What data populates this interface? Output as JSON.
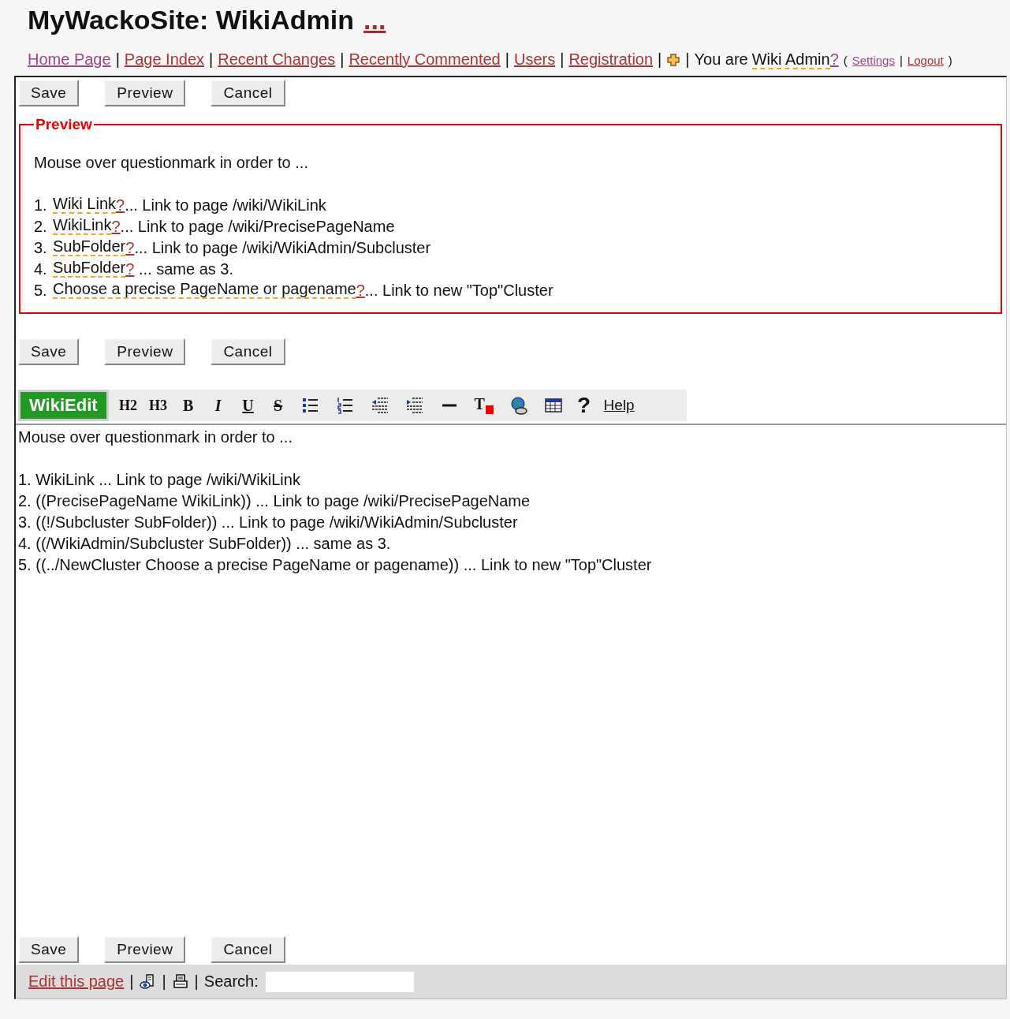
{
  "title": "MyWackoSite: WikiAdmin",
  "title_link": "...",
  "nav": [
    {
      "kind": "link",
      "text": "Home Page",
      "visited": true
    },
    {
      "kind": "sep",
      "text": "|"
    },
    {
      "kind": "link",
      "text": "Page Index",
      "visited": false
    },
    {
      "kind": "sep",
      "text": "|"
    },
    {
      "kind": "link",
      "text": "Recent Changes",
      "visited": false
    },
    {
      "kind": "sep",
      "text": "|"
    },
    {
      "kind": "link",
      "text": "Recently Commented",
      "visited": false
    },
    {
      "kind": "sep",
      "text": "|"
    },
    {
      "kind": "link",
      "text": "Users",
      "visited": false
    },
    {
      "kind": "sep",
      "text": "|"
    },
    {
      "kind": "link",
      "text": "Registration",
      "visited": false
    },
    {
      "kind": "sep",
      "text": "|"
    },
    {
      "kind": "plus"
    },
    {
      "kind": "sep",
      "text": "|"
    },
    {
      "kind": "text",
      "text": "You are"
    },
    {
      "kind": "pagename",
      "text": "Wiki Admin"
    },
    {
      "kind": "missing",
      "text": "?"
    },
    {
      "kind": "paren",
      "text": "("
    },
    {
      "kind": "small-link",
      "text": "Settings",
      "visited": true
    },
    {
      "kind": "small-sep",
      "text": "|"
    },
    {
      "kind": "small-link",
      "text": "Logout",
      "visited": false
    },
    {
      "kind": "paren",
      "text": ")"
    }
  ],
  "buttons_top": [
    "Save",
    "Preview",
    "Cancel"
  ],
  "preview": {
    "legend": "Preview",
    "intro": "Mouse over questionmark in order to ...",
    "items": [
      {
        "number": "1.",
        "page": "Wiki Link",
        "mark": "?",
        "rest": "... Link to page /wiki/WikiLink"
      },
      {
        "number": "2.",
        "page": "WikiLink",
        "mark": "?",
        "rest": "... Link to page /wiki/PrecisePageName"
      },
      {
        "number": "3.",
        "page": "SubFolder",
        "mark": "?",
        "rest": "... Link to page /wiki/WikiAdmin/Subcluster"
      },
      {
        "number": "4.",
        "page": "SubFolder",
        "mark": "?",
        "rest": " ... same as 3."
      },
      {
        "number": "5.",
        "page": "Choose a precise PageName or pagename",
        "mark": "?",
        "rest": "... Link to new \"Top\"Cluster"
      }
    ]
  },
  "buttons_middle": [
    "Save",
    "Preview",
    "Cancel"
  ],
  "toolbar": [
    {
      "kind": "brand",
      "text": "WikiEdit"
    },
    {
      "kind": "heading",
      "text": "H2"
    },
    {
      "kind": "heading",
      "text": "H3"
    },
    {
      "kind": "bold",
      "text": "B"
    },
    {
      "kind": "italic",
      "text": "I"
    },
    {
      "kind": "underline",
      "text": "U"
    },
    {
      "kind": "strike",
      "text": "S"
    },
    {
      "kind": "bullet-list"
    },
    {
      "kind": "numbered-list"
    },
    {
      "kind": "outdent"
    },
    {
      "kind": "indent"
    },
    {
      "kind": "rule"
    },
    {
      "kind": "text-color",
      "text": "T"
    },
    {
      "kind": "web-link"
    },
    {
      "kind": "table"
    },
    {
      "kind": "glyph",
      "text": "?"
    },
    {
      "kind": "help",
      "text": "Help"
    }
  ],
  "editor": {
    "intro": "Mouse over questionmark in order to ...",
    "lines": [
      "1. WikiLink ... Link to page /wiki/WikiLink",
      "2. ((PrecisePageName WikiLink)) ... Link to page /wiki/PrecisePageName",
      "3. ((!/Subcluster SubFolder)) ... Link to page /wiki/WikiAdmin/Subcluster",
      "4. ((/WikiAdmin/Subcluster SubFolder)) ... same as 3.",
      "5. ((../NewCluster Choose a precise PageName or pagename)) ... Link to new \"Top\"Cluster"
    ]
  },
  "buttons_bottom": [
    "Save",
    "Preview",
    "Cancel"
  ],
  "footer": [
    {
      "kind": "link",
      "text": "Edit this page"
    },
    {
      "kind": "sep",
      "text": "|"
    },
    {
      "kind": "eye-doc"
    },
    {
      "kind": "sep",
      "text": "|"
    },
    {
      "kind": "printer"
    },
    {
      "kind": "sep",
      "text": "|"
    },
    {
      "kind": "label",
      "text": "Search:"
    },
    {
      "kind": "search"
    }
  ]
}
